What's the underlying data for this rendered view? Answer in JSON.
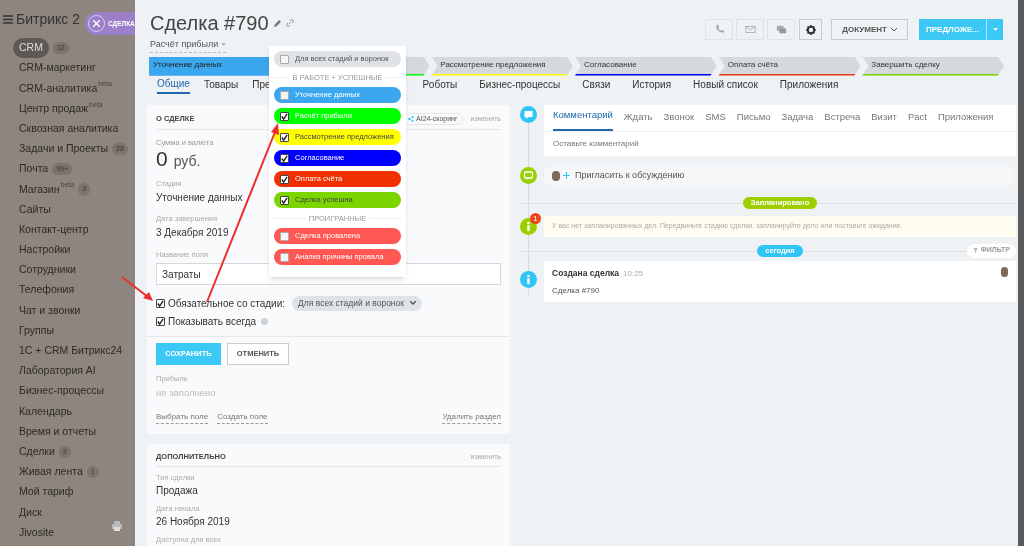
{
  "sidebar": {
    "brand": "Битрикс 2",
    "items": [
      {
        "label": "CRM",
        "badge": "12",
        "selected": true
      },
      {
        "label": "CRM-маркетинг",
        "selected": false
      },
      {
        "label": "CRM-аналитика",
        "sup": "beta",
        "selected": false
      },
      {
        "label": "Центр продаж",
        "sup": "beta",
        "selected": false
      },
      {
        "label": "Сквозная аналитика",
        "selected": false
      },
      {
        "label": "Задачи и Проекты",
        "badge": "28",
        "selected": false
      },
      {
        "label": "Почта",
        "badge": "99+",
        "selected": false
      },
      {
        "label": "Магазин",
        "sup": "beta",
        "badge": "3",
        "selected": false
      },
      {
        "label": "Сайты",
        "selected": false
      },
      {
        "label": "Контакт-центр",
        "selected": false
      },
      {
        "label": "Настройки",
        "selected": false
      },
      {
        "label": "Сотрудники",
        "selected": false
      },
      {
        "label": "Телефония",
        "selected": false
      },
      {
        "label": "Чат и звонки",
        "selected": false
      },
      {
        "label": "Группы",
        "selected": false
      },
      {
        "label": "1С + CRM Битрикс24",
        "selected": false
      },
      {
        "label": "Лаборатория AI",
        "selected": false
      },
      {
        "label": "Бизнес-процессы",
        "selected": false
      },
      {
        "label": "Календарь",
        "selected": false
      },
      {
        "label": "Время и отчеты",
        "selected": false
      },
      {
        "label": "Сделки",
        "badge": "3",
        "selected": false
      },
      {
        "label": "Живая лента",
        "badge": "1",
        "selected": false
      },
      {
        "label": "Мой тариф",
        "selected": false
      },
      {
        "label": "Диск",
        "selected": false
      },
      {
        "label": "Jivosite",
        "selected": false
      }
    ]
  },
  "slider_tab": {
    "label": "СДЕЛКА"
  },
  "header": {
    "title": "Сделка #790",
    "funnel": "Расчёт прибыли",
    "document_button": "ДОКУМЕНТ",
    "primary_button": "ПРЕДЛОЖЕ..."
  },
  "stages": [
    {
      "label": "Уточнение данных",
      "color": "#3ba7ee",
      "active": true
    },
    {
      "color": "#00ff00",
      "active": false
    },
    {
      "label": "Рассмотрение предложения",
      "color": "#ffff00",
      "active": false
    },
    {
      "label": "Согласование",
      "color": "#0000ff",
      "active": false
    },
    {
      "label": "Оплата счёта",
      "color": "#f03c15",
      "active": false
    },
    {
      "label": "Завершить сделку",
      "color": "#7bd500",
      "active": false
    }
  ],
  "tabs_left": [
    {
      "label": "Общие",
      "selected": true
    },
    {
      "label": "Товары",
      "selected": false
    },
    {
      "label": "Пре",
      "selected": false
    }
  ],
  "tabs_right": [
    {
      "label": "Роботы",
      "selected": false
    },
    {
      "label": "Бизнес-процессы",
      "selected": false
    },
    {
      "label": "Связи",
      "selected": false
    },
    {
      "label": "История",
      "selected": false
    },
    {
      "label": "Новый список",
      "selected": false
    },
    {
      "label": "Приложения",
      "selected": false
    }
  ],
  "about": {
    "title": "О СДЕЛКЕ",
    "scoring": "AI24-скоринг",
    "edit": "изменить",
    "fields": [
      {
        "label": "Сумма и валюта",
        "value": "0",
        "currency": "руб."
      },
      {
        "label": "Стадия",
        "value": "Уточнение данных"
      },
      {
        "label": "Дата завершения",
        "value": "3 Декабря 2019"
      }
    ],
    "editor": {
      "label": "Название поля",
      "value": "Затраты",
      "required_checked": true,
      "required_label": "Обязательное со стадии:",
      "required_select": "Для всех стадий и воронок",
      "show_checked": true,
      "show_label": "Показывать всегда"
    },
    "save": "СОХРАНИТЬ",
    "cancel": "ОТМЕНИТЬ",
    "profit_label": "Прибыль",
    "profit_value": "не заполнено",
    "links": [
      "Выбрать поле",
      "Создать поле"
    ],
    "delete": "Удалить раздел"
  },
  "extra": {
    "title": "ДОПОЛНИТЕЛЬНО",
    "edit": "изменить",
    "fields": [
      {
        "label": "Тип сделки",
        "value": "Продажа"
      },
      {
        "label": "Дата начала",
        "value": "26 Ноября 2019"
      },
      {
        "label": "Доступна для всех"
      }
    ]
  },
  "stage_dropdown": {
    "all": {
      "label": "Для всех стадий и воронок",
      "checked": false
    },
    "groups": [
      {
        "title": "В РАБОТЕ + УСПЕШНЫЕ",
        "items": [
          {
            "label": "Уточнение данных",
            "color": "#3ba7ee",
            "checked": false
          },
          {
            "label": "Расчёт прибыли",
            "color": "#00ff00",
            "checked": true
          },
          {
            "label": "Рассмотрение предложения",
            "color": "#ffff00",
            "checked": true
          },
          {
            "label": "Согласование",
            "color": "#0000ff",
            "checked": true
          },
          {
            "label": "Оплата счёта",
            "color": "#f03000",
            "checked": true
          },
          {
            "label": "Сделка успешна",
            "color": "#7bd500",
            "checked": true
          }
        ]
      },
      {
        "title": "ПРОИГРАННЫЕ",
        "items": [
          {
            "label": "Сделка провалена",
            "color": "#ff5752",
            "checked": false
          },
          {
            "label": "Анализ причины провала",
            "color": "#ff5752",
            "checked": false
          }
        ]
      }
    ]
  },
  "timeline": {
    "composer_tabs": [
      {
        "label": "Комментарий",
        "selected": true
      },
      {
        "label": "Ждать",
        "selected": false
      },
      {
        "label": "Звонок",
        "selected": false
      },
      {
        "label": "SMS",
        "selected": false
      },
      {
        "label": "Письмо",
        "selected": false
      },
      {
        "label": "Задача",
        "selected": false
      },
      {
        "label": "Встреча",
        "selected": false
      },
      {
        "label": "Визит",
        "selected": false
      },
      {
        "label": "Pact",
        "selected": false
      },
      {
        "label": "Приложения",
        "selected": false
      }
    ],
    "placeholder": "Оставьте комментарий",
    "invite": "Пригласить к обсуждению",
    "planned": "Запланировано",
    "notice_count": "1",
    "notice": "У вас нет запланированных дел. Передвиньте стадию сделки, запланируйте дело или поставьте ожидание.",
    "today": "сегодня",
    "filter": "ФИЛЬТР",
    "event_title": "Создана сделка",
    "event_time": "10:25",
    "event_text": "Сделка #790"
  }
}
